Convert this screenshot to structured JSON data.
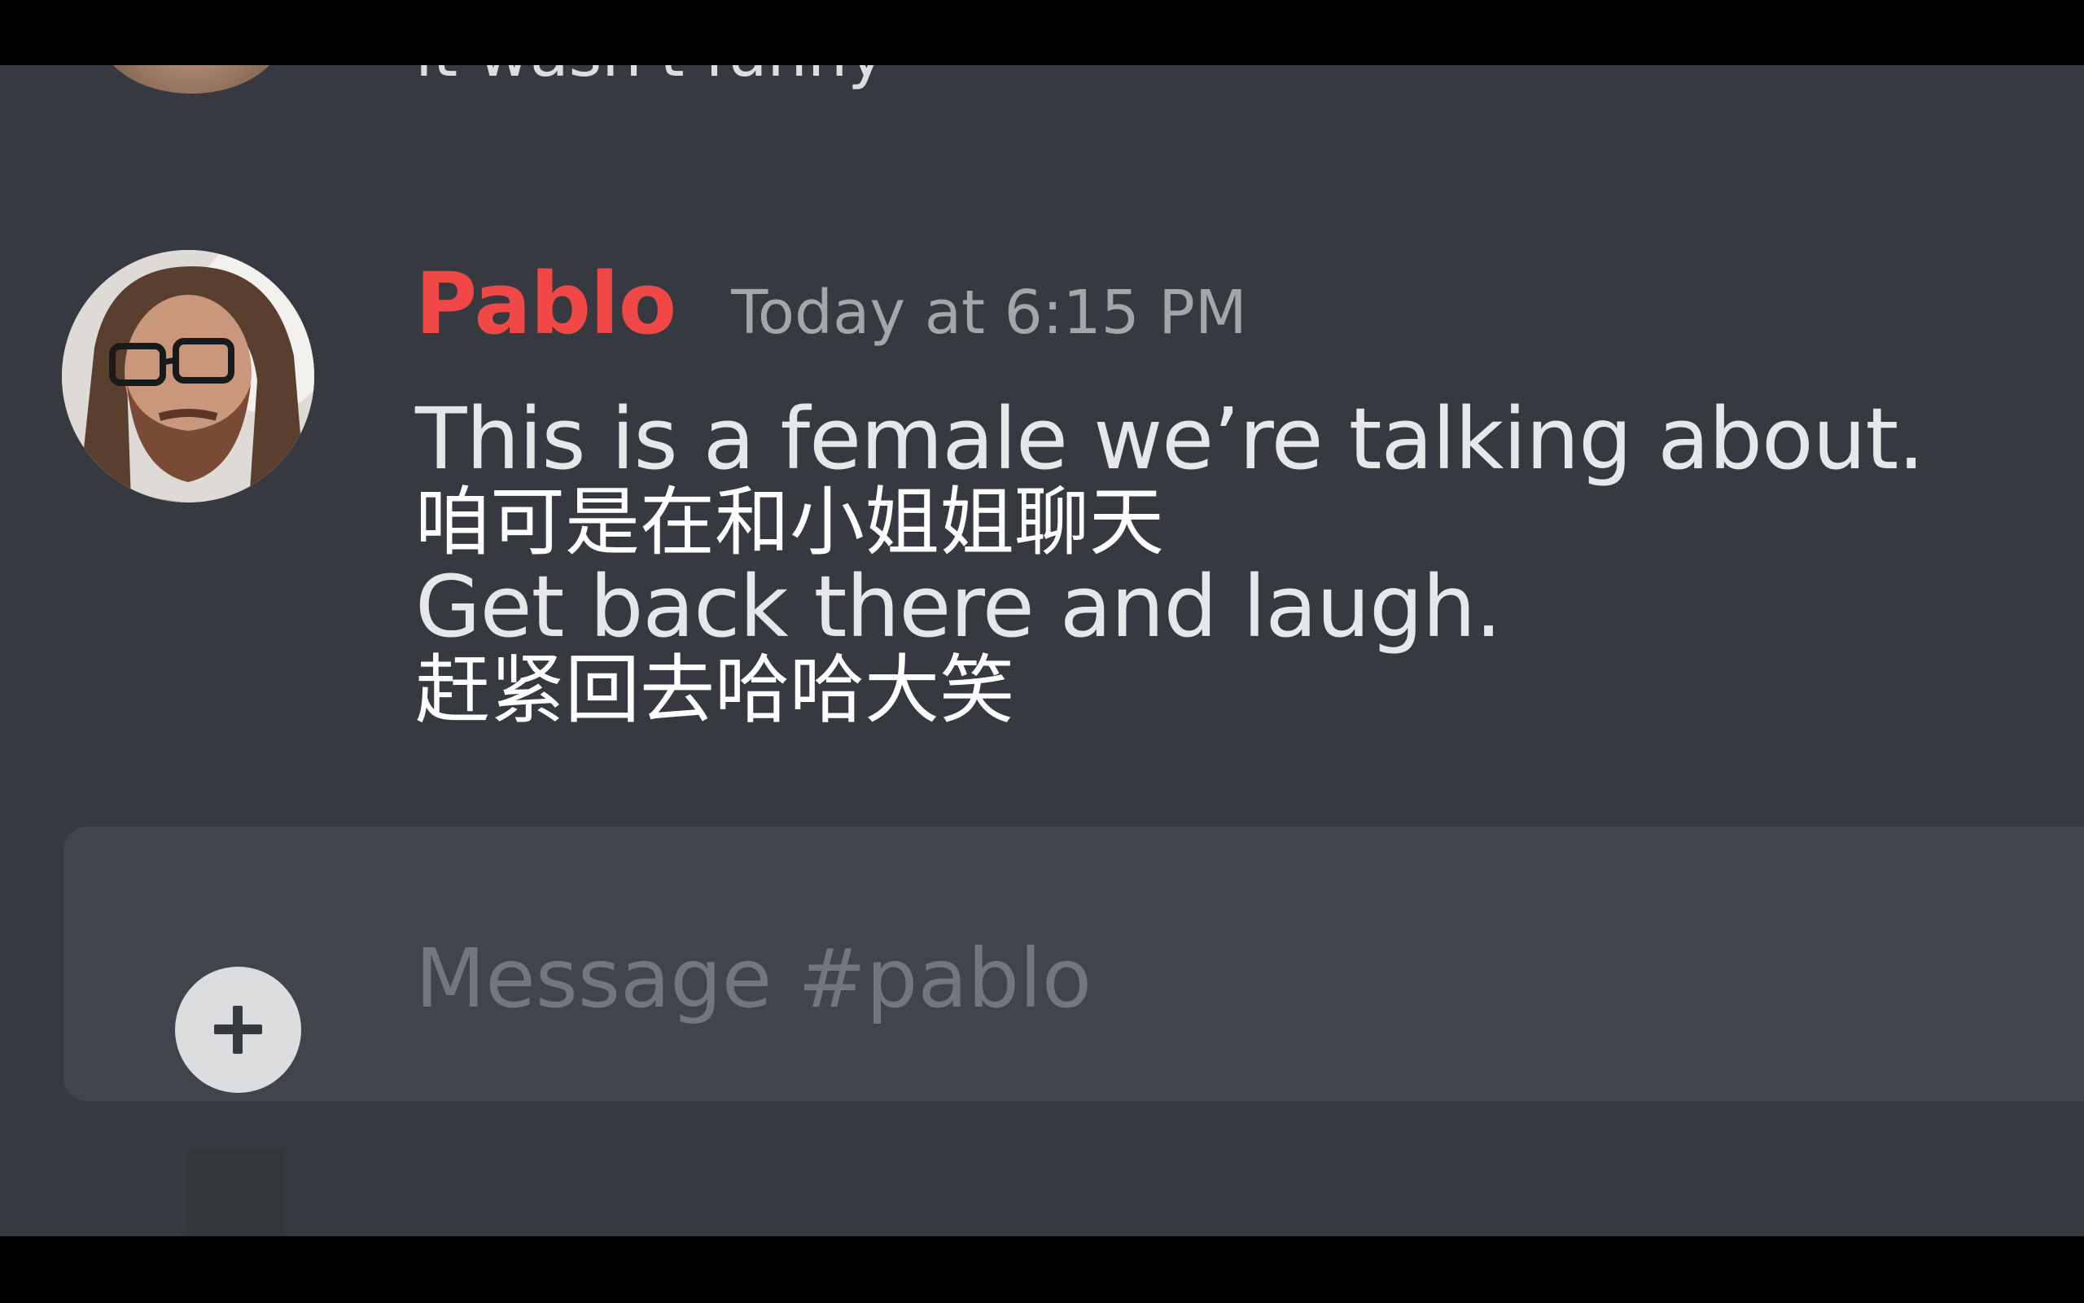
{
  "previous_message": {
    "text": "it wasn't funny"
  },
  "message": {
    "username": "Pablo",
    "username_color": "#f04747",
    "timestamp": "Today at 6:15 PM",
    "lines": {
      "line1": "This is a female we’re talking about.",
      "line2": "咱可是在和小姐姐聊天",
      "line3": "Get back there and laugh.",
      "line4": "赶紧回去哈哈大笑"
    }
  },
  "composer": {
    "placeholder": "Message #pablo"
  },
  "icons": {
    "attach": "plus-icon"
  }
}
